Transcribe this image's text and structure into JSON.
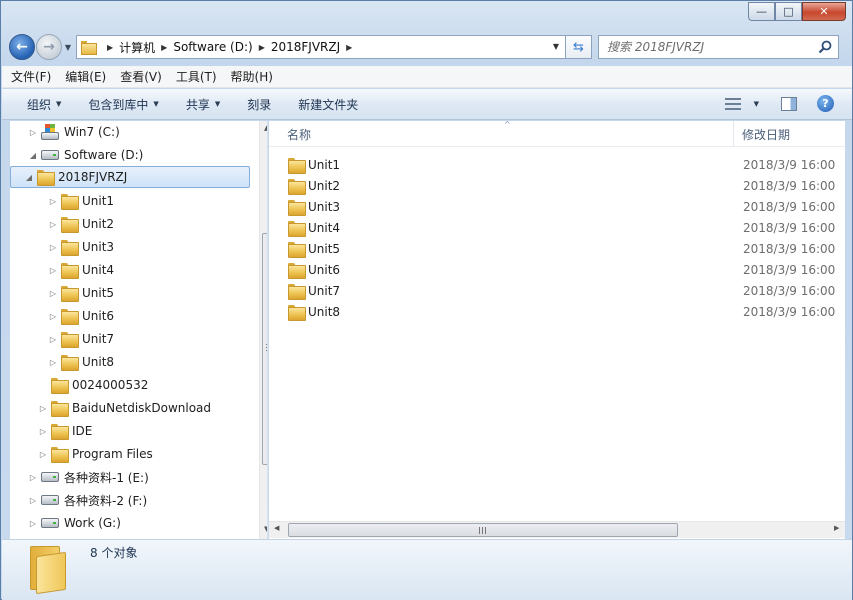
{
  "window": {
    "minimize_glyph": "—",
    "maximize_glyph": "□",
    "close_glyph": "✕"
  },
  "address": {
    "crumbs": [
      "计算机",
      "Software (D:)",
      "2018FJVRZJ"
    ]
  },
  "search": {
    "placeholder": "搜索 2018FJVRZJ"
  },
  "menu": [
    "文件(F)",
    "编辑(E)",
    "查看(V)",
    "工具(T)",
    "帮助(H)"
  ],
  "commands": {
    "organize": "组织",
    "include_library": "包含到库中",
    "share": "共享",
    "burn": "刻录",
    "new_folder": "新建文件夹"
  },
  "tree": [
    {
      "label": "Win7 (C:)"
    },
    {
      "label": "Software (D:)"
    },
    {
      "label": "2018FJVRZJ"
    },
    {
      "label": "Unit1"
    },
    {
      "label": "Unit2"
    },
    {
      "label": "Unit3"
    },
    {
      "label": "Unit4"
    },
    {
      "label": "Unit5"
    },
    {
      "label": "Unit6"
    },
    {
      "label": "Unit7"
    },
    {
      "label": "Unit8"
    },
    {
      "label": "0024000532"
    },
    {
      "label": "BaiduNetdiskDownload"
    },
    {
      "label": "IDE"
    },
    {
      "label": "Program Files"
    },
    {
      "label": "各种资料-1 (E:)"
    },
    {
      "label": "各种资料-2 (F:)"
    },
    {
      "label": "Work (G:)"
    }
  ],
  "columns": {
    "name": "名称",
    "modified": "修改日期"
  },
  "files": [
    {
      "name": "Unit1",
      "date": "2018/3/9 16:00"
    },
    {
      "name": "Unit2",
      "date": "2018/3/9 16:00"
    },
    {
      "name": "Unit3",
      "date": "2018/3/9 16:00"
    },
    {
      "name": "Unit4",
      "date": "2018/3/9 16:00"
    },
    {
      "name": "Unit5",
      "date": "2018/3/9 16:00"
    },
    {
      "name": "Unit6",
      "date": "2018/3/9 16:00"
    },
    {
      "name": "Unit7",
      "date": "2018/3/9 16:00"
    },
    {
      "name": "Unit8",
      "date": "2018/3/9 16:00"
    }
  ],
  "details": {
    "item_count": "8 个对象"
  }
}
